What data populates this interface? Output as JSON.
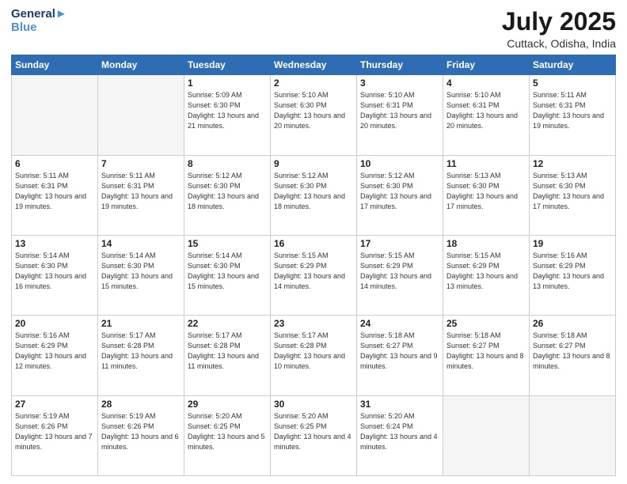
{
  "header": {
    "logo_line1": "General",
    "logo_line2": "Blue",
    "month": "July 2025",
    "location": "Cuttack, Odisha, India"
  },
  "weekdays": [
    "Sunday",
    "Monday",
    "Tuesday",
    "Wednesday",
    "Thursday",
    "Friday",
    "Saturday"
  ],
  "weeks": [
    [
      {
        "day": "",
        "info": ""
      },
      {
        "day": "",
        "info": ""
      },
      {
        "day": "1",
        "info": "Sunrise: 5:09 AM\nSunset: 6:30 PM\nDaylight: 13 hours and 21 minutes."
      },
      {
        "day": "2",
        "info": "Sunrise: 5:10 AM\nSunset: 6:30 PM\nDaylight: 13 hours and 20 minutes."
      },
      {
        "day": "3",
        "info": "Sunrise: 5:10 AM\nSunset: 6:31 PM\nDaylight: 13 hours and 20 minutes."
      },
      {
        "day": "4",
        "info": "Sunrise: 5:10 AM\nSunset: 6:31 PM\nDaylight: 13 hours and 20 minutes."
      },
      {
        "day": "5",
        "info": "Sunrise: 5:11 AM\nSunset: 6:31 PM\nDaylight: 13 hours and 19 minutes."
      }
    ],
    [
      {
        "day": "6",
        "info": "Sunrise: 5:11 AM\nSunset: 6:31 PM\nDaylight: 13 hours and 19 minutes."
      },
      {
        "day": "7",
        "info": "Sunrise: 5:11 AM\nSunset: 6:31 PM\nDaylight: 13 hours and 19 minutes."
      },
      {
        "day": "8",
        "info": "Sunrise: 5:12 AM\nSunset: 6:30 PM\nDaylight: 13 hours and 18 minutes."
      },
      {
        "day": "9",
        "info": "Sunrise: 5:12 AM\nSunset: 6:30 PM\nDaylight: 13 hours and 18 minutes."
      },
      {
        "day": "10",
        "info": "Sunrise: 5:12 AM\nSunset: 6:30 PM\nDaylight: 13 hours and 17 minutes."
      },
      {
        "day": "11",
        "info": "Sunrise: 5:13 AM\nSunset: 6:30 PM\nDaylight: 13 hours and 17 minutes."
      },
      {
        "day": "12",
        "info": "Sunrise: 5:13 AM\nSunset: 6:30 PM\nDaylight: 13 hours and 17 minutes."
      }
    ],
    [
      {
        "day": "13",
        "info": "Sunrise: 5:14 AM\nSunset: 6:30 PM\nDaylight: 13 hours and 16 minutes."
      },
      {
        "day": "14",
        "info": "Sunrise: 5:14 AM\nSunset: 6:30 PM\nDaylight: 13 hours and 15 minutes."
      },
      {
        "day": "15",
        "info": "Sunrise: 5:14 AM\nSunset: 6:30 PM\nDaylight: 13 hours and 15 minutes."
      },
      {
        "day": "16",
        "info": "Sunrise: 5:15 AM\nSunset: 6:29 PM\nDaylight: 13 hours and 14 minutes."
      },
      {
        "day": "17",
        "info": "Sunrise: 5:15 AM\nSunset: 6:29 PM\nDaylight: 13 hours and 14 minutes."
      },
      {
        "day": "18",
        "info": "Sunrise: 5:15 AM\nSunset: 6:29 PM\nDaylight: 13 hours and 13 minutes."
      },
      {
        "day": "19",
        "info": "Sunrise: 5:16 AM\nSunset: 6:29 PM\nDaylight: 13 hours and 13 minutes."
      }
    ],
    [
      {
        "day": "20",
        "info": "Sunrise: 5:16 AM\nSunset: 6:29 PM\nDaylight: 13 hours and 12 minutes."
      },
      {
        "day": "21",
        "info": "Sunrise: 5:17 AM\nSunset: 6:28 PM\nDaylight: 13 hours and 11 minutes."
      },
      {
        "day": "22",
        "info": "Sunrise: 5:17 AM\nSunset: 6:28 PM\nDaylight: 13 hours and 11 minutes."
      },
      {
        "day": "23",
        "info": "Sunrise: 5:17 AM\nSunset: 6:28 PM\nDaylight: 13 hours and 10 minutes."
      },
      {
        "day": "24",
        "info": "Sunrise: 5:18 AM\nSunset: 6:27 PM\nDaylight: 13 hours and 9 minutes."
      },
      {
        "day": "25",
        "info": "Sunrise: 5:18 AM\nSunset: 6:27 PM\nDaylight: 13 hours and 8 minutes."
      },
      {
        "day": "26",
        "info": "Sunrise: 5:18 AM\nSunset: 6:27 PM\nDaylight: 13 hours and 8 minutes."
      }
    ],
    [
      {
        "day": "27",
        "info": "Sunrise: 5:19 AM\nSunset: 6:26 PM\nDaylight: 13 hours and 7 minutes."
      },
      {
        "day": "28",
        "info": "Sunrise: 5:19 AM\nSunset: 6:26 PM\nDaylight: 13 hours and 6 minutes."
      },
      {
        "day": "29",
        "info": "Sunrise: 5:20 AM\nSunset: 6:25 PM\nDaylight: 13 hours and 5 minutes."
      },
      {
        "day": "30",
        "info": "Sunrise: 5:20 AM\nSunset: 6:25 PM\nDaylight: 13 hours and 4 minutes."
      },
      {
        "day": "31",
        "info": "Sunrise: 5:20 AM\nSunset: 6:24 PM\nDaylight: 13 hours and 4 minutes."
      },
      {
        "day": "",
        "info": ""
      },
      {
        "day": "",
        "info": ""
      }
    ]
  ]
}
